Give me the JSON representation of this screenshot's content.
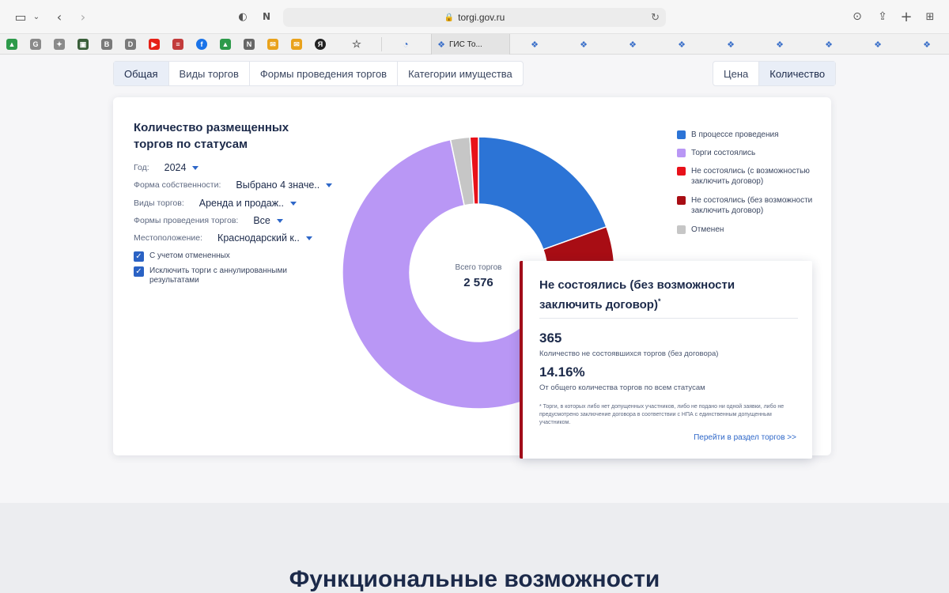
{
  "browser": {
    "url": "torgi.gov.ru",
    "active_tab_title": "ГИС То..."
  },
  "nav": {
    "tabs": [
      "Общая",
      "Виды торгов",
      "Формы проведения торгов",
      "Категории имущества"
    ],
    "active_tab": "Общая",
    "metric_toggle": [
      "Цена",
      "Количество"
    ],
    "active_metric": "Количество"
  },
  "card": {
    "title": "Количество размещенных торгов по статусам",
    "filters": [
      {
        "label": "Год:",
        "value": "2024"
      },
      {
        "label": "Форма собственности:",
        "value": "Выбрано 4 значе.."
      },
      {
        "label": "Виды торгов:",
        "value": "Аренда и продаж.."
      },
      {
        "label": "Формы проведения торгов:",
        "value": "Все"
      },
      {
        "label": "Местоположение:",
        "value": "Краснодарский к.."
      }
    ],
    "checkboxes": [
      {
        "label": "С учетом отмененных",
        "checked": true
      },
      {
        "label": "Исключить торги с аннулированными результатами",
        "checked": true
      }
    ],
    "total_label": "Всего торгов",
    "total_value": "2 576",
    "legend": [
      {
        "label": "В процессе проведения",
        "color": "#2c74d6"
      },
      {
        "label": "Торги состоялись",
        "color": "#b997f5"
      },
      {
        "label": "Не состоялись (с возможностью заключить договор)",
        "color": "#e8111a"
      },
      {
        "label": "Не состоялись (без возможности заключить договор)",
        "color": "#a80d14"
      },
      {
        "label": "Отменен",
        "color": "#c6c6c6"
      }
    ]
  },
  "chart_data": {
    "type": "pie",
    "categories": [
      "В процессе проведения",
      "Не состоялись (без возможности заключить договор)",
      "Торги состоялись",
      "Отменен",
      "Не состоялись (с возможностью заключить договор)"
    ],
    "values": [
      19.5,
      14.16,
      63.0,
      2.3,
      1.0
    ],
    "colors": [
      "#2c74d6",
      "#a80d14",
      "#b997f5",
      "#c6c6c6",
      "#e8111a"
    ],
    "total": 2576
  },
  "tooltip": {
    "title": "Не состоялись (без возможности заключить договор)",
    "marker": "*",
    "count": "365",
    "count_caption": "Количество не состоявшихся торгов (без договора)",
    "percent": "14.16%",
    "percent_caption": "От общего количества торгов по всем статусам",
    "note": "* Торги, в которых либо нет допущенных участников, либо не подано ни одной заявки, либо не предусмотрено заключение договора в соответствии с НПА с единственным допущенным участником.",
    "link": "Перейти в раздел торгов  >>"
  },
  "section": {
    "title": "Функциональные возможности"
  }
}
